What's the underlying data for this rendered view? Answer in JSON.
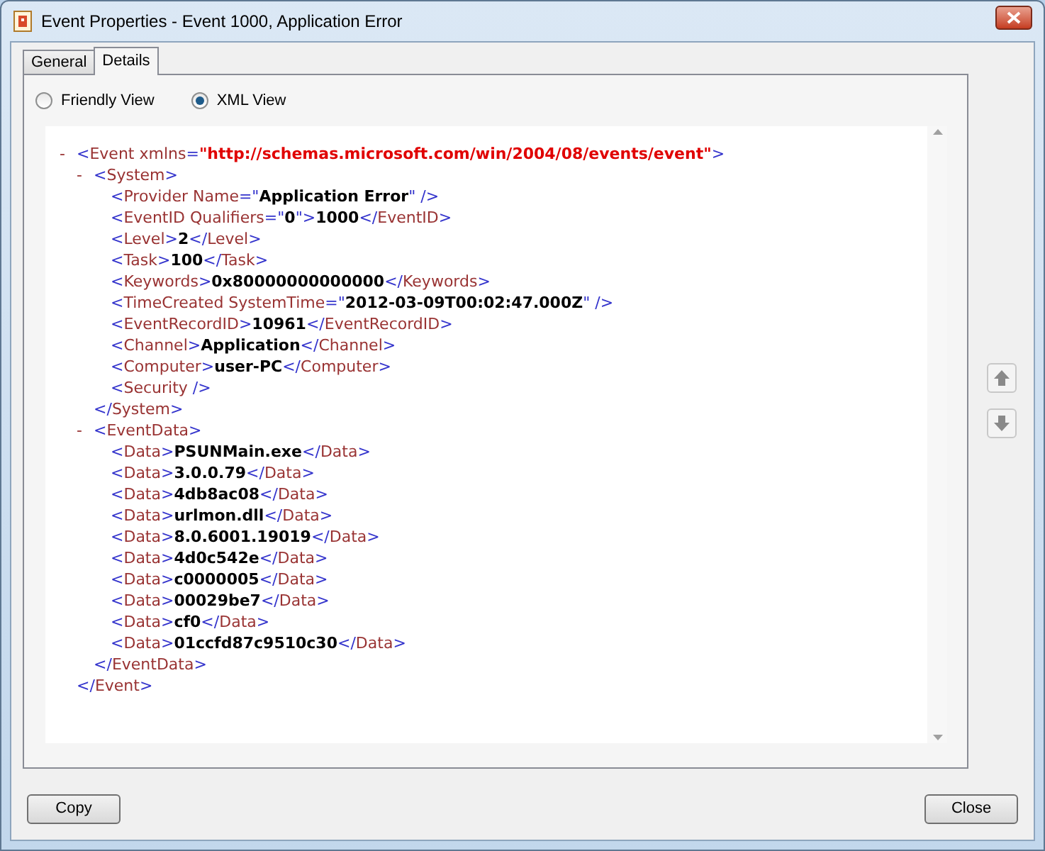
{
  "window": {
    "title": "Event Properties - Event 1000, Application Error"
  },
  "tabs": [
    {
      "label": "General",
      "selected": false
    },
    {
      "label": "Details",
      "selected": true
    }
  ],
  "view_options": [
    {
      "label": "Friendly View",
      "selected": false
    },
    {
      "label": "XML View",
      "selected": true
    }
  ],
  "xml": {
    "toggle": "-",
    "line": [
      {
        "kind": "punct",
        "text": "<"
      },
      {
        "kind": "name",
        "text": "Event xmlns"
      },
      {
        "kind": "punct",
        "text": "="
      },
      {
        "kind": "ns",
        "text": "\"http://schemas.microsoft.com/win/2004/08/events/event\""
      },
      {
        "kind": "punct",
        "text": ">"
      }
    ],
    "end": [
      {
        "kind": "punct",
        "text": "</"
      },
      {
        "kind": "name",
        "text": "Event"
      },
      {
        "kind": "punct",
        "text": ">"
      }
    ],
    "children": [
      {
        "toggle": "-",
        "line": [
          {
            "kind": "punct",
            "text": "<"
          },
          {
            "kind": "name",
            "text": "System"
          },
          {
            "kind": "punct",
            "text": ">"
          }
        ],
        "end": [
          {
            "kind": "punct",
            "text": "</"
          },
          {
            "kind": "name",
            "text": "System"
          },
          {
            "kind": "punct",
            "text": ">"
          }
        ],
        "children": [
          {
            "line": [
              {
                "kind": "punct",
                "text": "<"
              },
              {
                "kind": "name",
                "text": "Provider Name"
              },
              {
                "kind": "punct",
                "text": "=\""
              },
              {
                "kind": "value",
                "text": "Application Error"
              },
              {
                "kind": "punct",
                "text": "\" />"
              }
            ]
          },
          {
            "line": [
              {
                "kind": "punct",
                "text": "<"
              },
              {
                "kind": "name",
                "text": "EventID Qualifiers"
              },
              {
                "kind": "punct",
                "text": "=\""
              },
              {
                "kind": "value",
                "text": "0"
              },
              {
                "kind": "punct",
                "text": "\">"
              },
              {
                "kind": "value",
                "text": "1000"
              },
              {
                "kind": "punct",
                "text": "</"
              },
              {
                "kind": "name",
                "text": "EventID"
              },
              {
                "kind": "punct",
                "text": ">"
              }
            ]
          },
          {
            "line": [
              {
                "kind": "punct",
                "text": "<"
              },
              {
                "kind": "name",
                "text": "Level"
              },
              {
                "kind": "punct",
                "text": ">"
              },
              {
                "kind": "value",
                "text": "2"
              },
              {
                "kind": "punct",
                "text": "</"
              },
              {
                "kind": "name",
                "text": "Level"
              },
              {
                "kind": "punct",
                "text": ">"
              }
            ]
          },
          {
            "line": [
              {
                "kind": "punct",
                "text": "<"
              },
              {
                "kind": "name",
                "text": "Task"
              },
              {
                "kind": "punct",
                "text": ">"
              },
              {
                "kind": "value",
                "text": "100"
              },
              {
                "kind": "punct",
                "text": "</"
              },
              {
                "kind": "name",
                "text": "Task"
              },
              {
                "kind": "punct",
                "text": ">"
              }
            ]
          },
          {
            "line": [
              {
                "kind": "punct",
                "text": "<"
              },
              {
                "kind": "name",
                "text": "Keywords"
              },
              {
                "kind": "punct",
                "text": ">"
              },
              {
                "kind": "value",
                "text": "0x80000000000000"
              },
              {
                "kind": "punct",
                "text": "</"
              },
              {
                "kind": "name",
                "text": "Keywords"
              },
              {
                "kind": "punct",
                "text": ">"
              }
            ]
          },
          {
            "line": [
              {
                "kind": "punct",
                "text": "<"
              },
              {
                "kind": "name",
                "text": "TimeCreated SystemTime"
              },
              {
                "kind": "punct",
                "text": "=\""
              },
              {
                "kind": "value",
                "text": "2012-03-09T00:02:47.000Z"
              },
              {
                "kind": "punct",
                "text": "\" />"
              }
            ]
          },
          {
            "line": [
              {
                "kind": "punct",
                "text": "<"
              },
              {
                "kind": "name",
                "text": "EventRecordID"
              },
              {
                "kind": "punct",
                "text": ">"
              },
              {
                "kind": "value",
                "text": "10961"
              },
              {
                "kind": "punct",
                "text": "</"
              },
              {
                "kind": "name",
                "text": "EventRecordID"
              },
              {
                "kind": "punct",
                "text": ">"
              }
            ]
          },
          {
            "line": [
              {
                "kind": "punct",
                "text": "<"
              },
              {
                "kind": "name",
                "text": "Channel"
              },
              {
                "kind": "punct",
                "text": ">"
              },
              {
                "kind": "value",
                "text": "Application"
              },
              {
                "kind": "punct",
                "text": "</"
              },
              {
                "kind": "name",
                "text": "Channel"
              },
              {
                "kind": "punct",
                "text": ">"
              }
            ]
          },
          {
            "line": [
              {
                "kind": "punct",
                "text": "<"
              },
              {
                "kind": "name",
                "text": "Computer"
              },
              {
                "kind": "punct",
                "text": ">"
              },
              {
                "kind": "value",
                "text": "user-PC"
              },
              {
                "kind": "punct",
                "text": "</"
              },
              {
                "kind": "name",
                "text": "Computer"
              },
              {
                "kind": "punct",
                "text": ">"
              }
            ]
          },
          {
            "line": [
              {
                "kind": "punct",
                "text": "<"
              },
              {
                "kind": "name",
                "text": "Security"
              },
              {
                "kind": "punct",
                "text": " />"
              }
            ]
          }
        ]
      },
      {
        "toggle": "-",
        "line": [
          {
            "kind": "punct",
            "text": "<"
          },
          {
            "kind": "name",
            "text": "EventData"
          },
          {
            "kind": "punct",
            "text": ">"
          }
        ],
        "end": [
          {
            "kind": "punct",
            "text": "</"
          },
          {
            "kind": "name",
            "text": "EventData"
          },
          {
            "kind": "punct",
            "text": ">"
          }
        ],
        "children": [
          {
            "line": [
              {
                "kind": "punct",
                "text": "<"
              },
              {
                "kind": "name",
                "text": "Data"
              },
              {
                "kind": "punct",
                "text": ">"
              },
              {
                "kind": "value",
                "text": "PSUNMain.exe"
              },
              {
                "kind": "punct",
                "text": "</"
              },
              {
                "kind": "name",
                "text": "Data"
              },
              {
                "kind": "punct",
                "text": ">"
              }
            ]
          },
          {
            "line": [
              {
                "kind": "punct",
                "text": "<"
              },
              {
                "kind": "name",
                "text": "Data"
              },
              {
                "kind": "punct",
                "text": ">"
              },
              {
                "kind": "value",
                "text": "3.0.0.79"
              },
              {
                "kind": "punct",
                "text": "</"
              },
              {
                "kind": "name",
                "text": "Data"
              },
              {
                "kind": "punct",
                "text": ">"
              }
            ]
          },
          {
            "line": [
              {
                "kind": "punct",
                "text": "<"
              },
              {
                "kind": "name",
                "text": "Data"
              },
              {
                "kind": "punct",
                "text": ">"
              },
              {
                "kind": "value",
                "text": "4db8ac08"
              },
              {
                "kind": "punct",
                "text": "</"
              },
              {
                "kind": "name",
                "text": "Data"
              },
              {
                "kind": "punct",
                "text": ">"
              }
            ]
          },
          {
            "line": [
              {
                "kind": "punct",
                "text": "<"
              },
              {
                "kind": "name",
                "text": "Data"
              },
              {
                "kind": "punct",
                "text": ">"
              },
              {
                "kind": "value",
                "text": "urlmon.dll"
              },
              {
                "kind": "punct",
                "text": "</"
              },
              {
                "kind": "name",
                "text": "Data"
              },
              {
                "kind": "punct",
                "text": ">"
              }
            ]
          },
          {
            "line": [
              {
                "kind": "punct",
                "text": "<"
              },
              {
                "kind": "name",
                "text": "Data"
              },
              {
                "kind": "punct",
                "text": ">"
              },
              {
                "kind": "value",
                "text": "8.0.6001.19019"
              },
              {
                "kind": "punct",
                "text": "</"
              },
              {
                "kind": "name",
                "text": "Data"
              },
              {
                "kind": "punct",
                "text": ">"
              }
            ]
          },
          {
            "line": [
              {
                "kind": "punct",
                "text": "<"
              },
              {
                "kind": "name",
                "text": "Data"
              },
              {
                "kind": "punct",
                "text": ">"
              },
              {
                "kind": "value",
                "text": "4d0c542e"
              },
              {
                "kind": "punct",
                "text": "</"
              },
              {
                "kind": "name",
                "text": "Data"
              },
              {
                "kind": "punct",
                "text": ">"
              }
            ]
          },
          {
            "line": [
              {
                "kind": "punct",
                "text": "<"
              },
              {
                "kind": "name",
                "text": "Data"
              },
              {
                "kind": "punct",
                "text": ">"
              },
              {
                "kind": "value",
                "text": "c0000005"
              },
              {
                "kind": "punct",
                "text": "</"
              },
              {
                "kind": "name",
                "text": "Data"
              },
              {
                "kind": "punct",
                "text": ">"
              }
            ]
          },
          {
            "line": [
              {
                "kind": "punct",
                "text": "<"
              },
              {
                "kind": "name",
                "text": "Data"
              },
              {
                "kind": "punct",
                "text": ">"
              },
              {
                "kind": "value",
                "text": "00029be7"
              },
              {
                "kind": "punct",
                "text": "</"
              },
              {
                "kind": "name",
                "text": "Data"
              },
              {
                "kind": "punct",
                "text": ">"
              }
            ]
          },
          {
            "line": [
              {
                "kind": "punct",
                "text": "<"
              },
              {
                "kind": "name",
                "text": "Data"
              },
              {
                "kind": "punct",
                "text": ">"
              },
              {
                "kind": "value",
                "text": "cf0"
              },
              {
                "kind": "punct",
                "text": "</"
              },
              {
                "kind": "name",
                "text": "Data"
              },
              {
                "kind": "punct",
                "text": ">"
              }
            ]
          },
          {
            "line": [
              {
                "kind": "punct",
                "text": "<"
              },
              {
                "kind": "name",
                "text": "Data"
              },
              {
                "kind": "punct",
                "text": ">"
              },
              {
                "kind": "value",
                "text": "01ccfd87c9510c30"
              },
              {
                "kind": "punct",
                "text": "</"
              },
              {
                "kind": "name",
                "text": "Data"
              },
              {
                "kind": "punct",
                "text": ">"
              }
            ]
          }
        ]
      }
    ]
  },
  "buttons": [
    {
      "label": "Copy"
    },
    {
      "label": "Close"
    }
  ]
}
